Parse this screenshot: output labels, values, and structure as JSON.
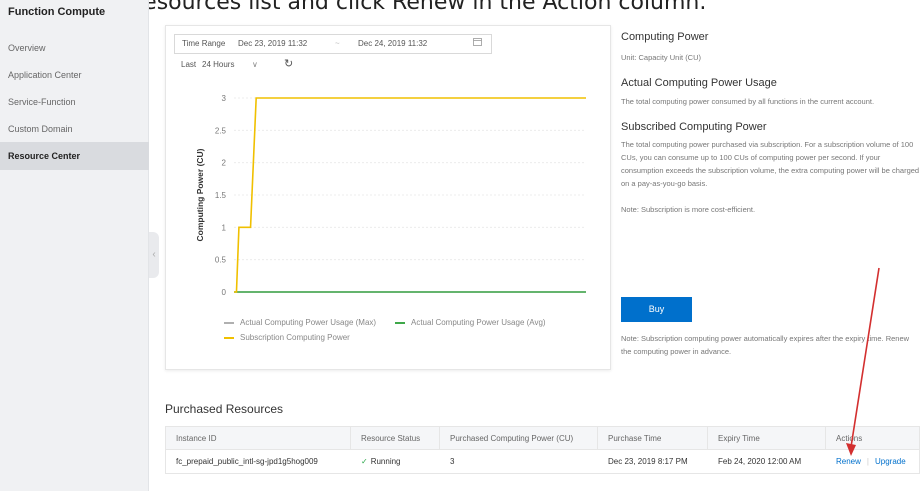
{
  "caption": "Purchased Resources list and click Renew in the Action column.",
  "sidebar": {
    "title": "Function Compute",
    "items": [
      {
        "label": "Overview"
      },
      {
        "label": "Application Center"
      },
      {
        "label": "Service-Function"
      },
      {
        "label": "Custom Domain"
      },
      {
        "label": "Resource Center",
        "active": true
      }
    ]
  },
  "filters": {
    "time_range_label": "Time Range",
    "start": "Dec 23, 2019 11:32",
    "separator": "~",
    "end": "Dec 24, 2019 11:32",
    "last_label": "Last",
    "period": "24 Hours"
  },
  "chart_data": {
    "type": "line",
    "ylabel": "Computing Power (CU)",
    "ylim": [
      0,
      3
    ],
    "yticks": [
      "3",
      "2.5",
      "2",
      "1.5",
      "1",
      "0.5",
      "0"
    ],
    "series": [
      {
        "name": "Actual Computing Power Usage (Max)",
        "color": "#b0b0b0",
        "points": [
          [
            0,
            0
          ],
          [
            1,
            0
          ]
        ]
      },
      {
        "name": "Actual Computing Power Usage (Avg)",
        "color": "#3fa84a",
        "points": [
          [
            0,
            0
          ],
          [
            1,
            0
          ]
        ]
      },
      {
        "name": "Subscription Computing Power",
        "color": "#f0c000",
        "points": [
          [
            0,
            0
          ],
          [
            0.007,
            0
          ],
          [
            0.014,
            1
          ],
          [
            0.047,
            1
          ],
          [
            0.063,
            3
          ],
          [
            1,
            3
          ]
        ]
      }
    ]
  },
  "info": {
    "computing_power_title": "Computing Power",
    "unit_text": "Unit: Capacity Unit (CU)",
    "actual_title": "Actual Computing Power Usage",
    "actual_desc": "The total computing power consumed by all functions in the current account.",
    "subscribed_title": "Subscribed Computing Power",
    "subscribed_desc": "The total computing power purchased via subscription. For a subscription volume of 100 CUs, you can consume up to 100 CUs of computing power per second. If your consumption exceeds the subscription volume, the extra computing power will be charged on a pay-as-you-go basis.",
    "note1": "Note: Subscription is more cost-efficient.",
    "buy_label": "Buy",
    "note2": "Note: Subscription computing power automatically expires after the expiry time. Renew the computing power in advance."
  },
  "purchased": {
    "title": "Purchased Resources",
    "columns": [
      "Instance ID",
      "Resource Status",
      "Purchased Computing Power (CU)",
      "Purchase Time",
      "Expiry Time",
      "Actions"
    ],
    "row": {
      "instance_id": "fc_prepaid_public_intl-sg-jpd1g5hog009",
      "status": "Running",
      "power": "3",
      "purchase_time": "Dec 23, 2019 8:17 PM",
      "expiry_time": "Feb 24, 2020 12:00 AM",
      "renew": "Renew",
      "separator": "|",
      "upgrade": "Upgrade"
    }
  },
  "colors": {
    "accent": "#0070cc",
    "annotation_arrow": "#d32f2f"
  }
}
